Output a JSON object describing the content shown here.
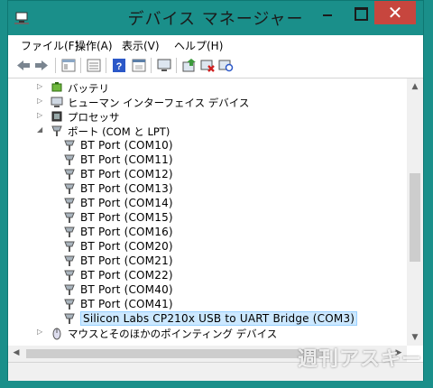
{
  "window": {
    "title": "デバイス マネージャー"
  },
  "menu": [
    "ファイル(F)",
    "操作(A)",
    "表示(V)",
    "ヘルプ(H)"
  ],
  "toolbar": {
    "buttons": [
      "back-arrow-icon",
      "forward-arrow-icon",
      "tree-view-icon",
      "properties-icon",
      "help-icon",
      "view-toggle-icon",
      "monitor-icon",
      "update-driver-icon",
      "disable-device-icon",
      "scan-hardware-icon"
    ]
  },
  "tree": {
    "top_nodes": [
      {
        "label": "バッテリ",
        "state": "collapsed",
        "icon": "battery-icon"
      },
      {
        "label": "ヒューマン インターフェイス デバイス",
        "state": "collapsed",
        "icon": "hid-icon"
      },
      {
        "label": "プロセッサ",
        "state": "collapsed",
        "icon": "processor-icon"
      },
      {
        "label": "ポート (COM と LPT)",
        "state": "expanded",
        "icon": "port-icon"
      }
    ],
    "ports": [
      "BT Port (COM10)",
      "BT Port (COM11)",
      "BT Port (COM12)",
      "BT Port (COM13)",
      "BT Port (COM14)",
      "BT Port (COM15)",
      "BT Port (COM16)",
      "BT Port (COM20)",
      "BT Port (COM21)",
      "BT Port (COM22)",
      "BT Port (COM40)",
      "BT Port (COM41)",
      "Silicon Labs CP210x USB to UART Bridge (COM3)"
    ],
    "selected_port": "Silicon Labs CP210x USB to UART Bridge (COM3)",
    "bottom_nodes": [
      {
        "label": "マウスとそのほかのポインティング デバイス",
        "state": "collapsed",
        "icon": "mouse-icon"
      }
    ]
  },
  "watermark": "週刊アスキー",
  "colors": {
    "titlebar": "#1a8f8a",
    "close": "#c7463e",
    "selection": "#cce8ff"
  }
}
